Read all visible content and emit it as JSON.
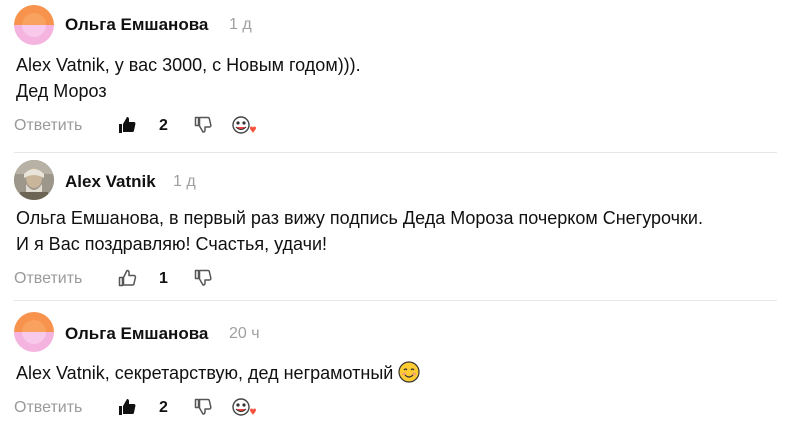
{
  "comments": [
    {
      "author": "Ольга Емшанова",
      "time": "1 д",
      "lines": [
        "Alex Vatnik, у вас 3000, с Новым годом))).",
        "Дед Мороз"
      ],
      "reply_label": "Ответить",
      "likes": "2",
      "liked": true
    },
    {
      "author": "Alex Vatnik",
      "time": "1 д",
      "lines": [
        "Ольга Емшанова, в первый раз вижу подпись Деда Мороза почерком Снегурочки.",
        "И я Вас поздравляю! Счастья, удачи!"
      ],
      "reply_label": "Ответить",
      "likes": "1",
      "liked": false
    },
    {
      "author": "Ольга Емшанова",
      "time": "20 ч",
      "lines": [
        "Alex Vatnik, секретарствую, дед неграмотный"
      ],
      "reply_label": "Ответить",
      "likes": "2",
      "liked": true
    }
  ],
  "icons": {
    "like": "thumbs-up-icon",
    "dislike": "thumbs-down-icon",
    "reaction": "reaction-emoji-icon",
    "smile": "smiling-face-emoji"
  },
  "colors": {
    "meta_gray": "#9a9a9a",
    "avatar_orange": "#f7934d",
    "avatar_pink": "#f5b3df",
    "heart": "#f5523c"
  }
}
